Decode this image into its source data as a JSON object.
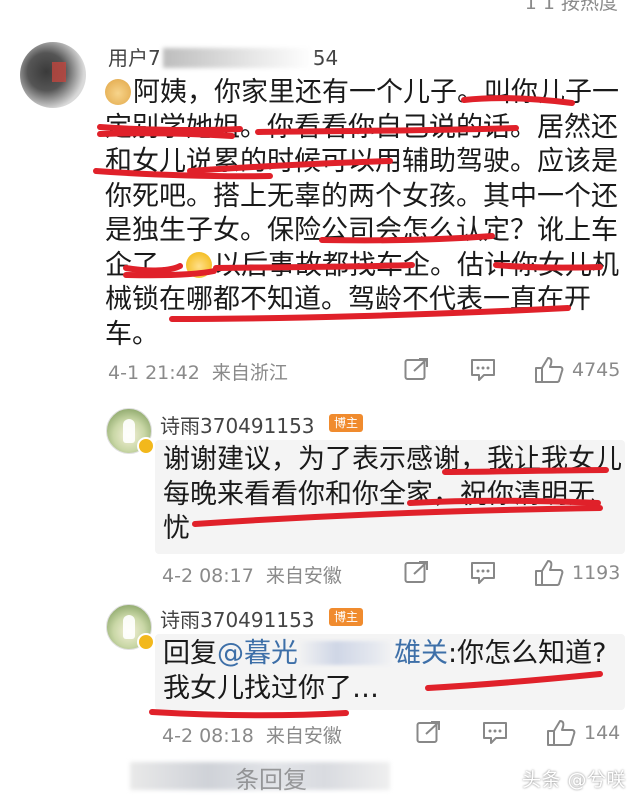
{
  "top_fragment": "1 1 按热度",
  "comment": {
    "user_prefix": "用户7",
    "user_suffix": "54",
    "lines": [
      "阿姨，你家里还有一个儿子。叫你儿子一",
      "定别学她姐。你看看你自己说的话。居然还",
      "和女儿说累的时候可以用辅助驾驶。应该是",
      "你死吧。搭上无辜的两个女孩。其中一个还",
      "是独生子女。保险公司会怎么认定？讹上车",
      "企了。",
      "以后事故都找车企。估计你女儿机",
      "械锁在哪都不知道。驾龄不代表一直在开",
      "车。"
    ],
    "emoji_first": "doge-emoji",
    "emoji_inline": "crying-laugh-emoji",
    "date": "4-1 21:42",
    "location": "来自浙江",
    "likes": "4745"
  },
  "reply1": {
    "username": "诗雨370491153",
    "badge": "博主",
    "lines": [
      "谢谢建议，为了表示感谢，我让我女儿",
      "每晚来看看你和你全家，祝你清明无",
      "忧"
    ],
    "date": "4-2 08:17",
    "location": "来自安徽",
    "likes": "1193"
  },
  "reply2": {
    "username": "诗雨370491153",
    "badge": "博主",
    "reply_prefix": "回复",
    "mention_start": "@暮光",
    "mention_end": "雄关",
    "reply_rest": ":你怎么知道?",
    "line2": "我女儿找过你了…",
    "date": "4-2 08:18",
    "location": "来自安徽",
    "likes": "144"
  },
  "bottom_fragment": "条回复",
  "watermark": "头条 @兮咲",
  "colors": {
    "underline": "#e0212a",
    "meta": "#8a8a8a",
    "mention": "#3d6fa8",
    "badge": "#f08b2e"
  },
  "icons": [
    "share-icon",
    "comment-icon",
    "like-icon"
  ]
}
